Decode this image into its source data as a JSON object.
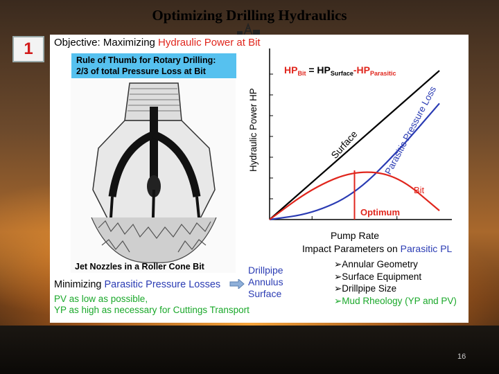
{
  "slide": {
    "title": "Optimizing Drilling Hydraulics",
    "number_badge": "1",
    "page_number": "16"
  },
  "panel": {
    "objective_prefix": "Objective: Maximizing ",
    "objective_highlight": "Hydraulic Power at Bit",
    "rule_line1": "Rule of Thumb for Rotary Drilling:",
    "rule_line2": "2/3 of total Pressure Loss at Bit",
    "bit_caption": "Jet Nozzles in a Roller Cone Bit",
    "minimizing_prefix": "Minimizing ",
    "minimizing_highlight": "Parasitic Pressure Losses",
    "loss_sources": [
      "Drillpipe",
      "Annulus",
      "Surface"
    ],
    "pv_line": "PV as low as possible,",
    "yp_line": "YP as high as necessary for Cuttings Transport"
  },
  "chart": {
    "eq_hp": "HP",
    "eq_sub_bit": "Bit",
    "eq_equals": " = HP",
    "eq_sub_surface": "Surface",
    "eq_minus": "-HP",
    "eq_sub_parasitic": "Parasitic",
    "ylabel": "Hydraulic Power HP",
    "xlabel": "Pump Rate",
    "label_surface": "Surface",
    "label_parasitic": "Parasitic Pressure Loss",
    "label_bit": "Bit",
    "label_optimum": "Optimum",
    "impact_prefix": "Impact Parameters on ",
    "impact_highlight": "Parasitic PL",
    "parameters": [
      "➢Annular Geometry",
      "➢Surface Equipment",
      "➢Drillpipe Size",
      "➢Mud Rheology (YP and PV)"
    ],
    "colors": {
      "surface": "#000000",
      "parasitic": "#2a3bb3",
      "bit": "#e0261d",
      "optimum": "#e0261d"
    }
  },
  "chart_data": {
    "type": "line",
    "title": "",
    "xlabel": "Pump Rate",
    "ylabel": "Hydraulic Power HP",
    "series": [
      {
        "name": "Surface",
        "x": [
          0,
          0.25,
          0.5,
          0.75,
          1.0
        ],
        "values": [
          0,
          0.25,
          0.5,
          0.75,
          1.0
        ]
      },
      {
        "name": "Parasitic Pressure Loss",
        "x": [
          0,
          0.25,
          0.5,
          0.75,
          1.0
        ],
        "values": [
          0,
          0.04,
          0.17,
          0.45,
          0.78
        ]
      },
      {
        "name": "Bit",
        "x": [
          0,
          0.25,
          0.5,
          0.75,
          1.0
        ],
        "values": [
          0,
          0.21,
          0.33,
          0.3,
          0.06
        ]
      }
    ],
    "optimum_x": 0.5
  }
}
